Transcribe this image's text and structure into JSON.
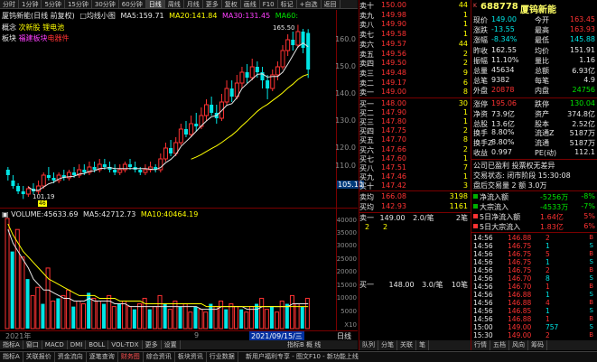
{
  "toolbar": {
    "title": "厦钨新能(日线 前复权)",
    "small_chart_label": "均线小图",
    "periods": [
      "分时",
      "1分钟",
      "5分钟",
      "15分钟",
      "30分钟",
      "60分钟",
      "日线",
      "周线",
      "月线",
      "更多"
    ],
    "actions": [
      "复权",
      "画线",
      "F10",
      "标记",
      "+自选",
      "返回"
    ],
    "ma5_label": "MA5:",
    "ma5_value": "159.71",
    "ma20_label": "MA20:",
    "ma20_value": "141.84",
    "ma30_label": "MA30:",
    "ma30_value": "131.45",
    "ma60_label": "MA60:"
  },
  "stock_tags": {
    "concept_label": "概念",
    "concept_value": "次新股 锂电池",
    "sector_label": "板块",
    "sector_value": "福建板块",
    "sector_extra": "电器件"
  },
  "price_axis": [
    "160.0",
    "150.0",
    "140.0",
    "130.0",
    "120.0",
    "110.0"
  ],
  "price_chart": {
    "high_label": "165.50",
    "low_label": "101.19",
    "current_price_tag": "105.10",
    "marker": "46"
  },
  "volume_panel": {
    "volume_label": "VOLUME:",
    "volume_value": "45633.69",
    "ma5_label": "MA5:",
    "ma5_value": "42712.73",
    "ma10_label": "MA10:",
    "ma10_value": "40464.19",
    "axis": [
      "40000",
      "35000",
      "30000",
      "25000",
      "20000",
      "15000",
      "10000",
      "5000"
    ],
    "unit_label": "X10",
    "volumes": [
      40,
      28,
      36,
      26,
      18,
      12,
      15,
      9,
      22,
      10,
      11,
      12,
      14,
      8,
      10,
      9,
      13,
      11,
      10,
      9,
      12,
      8,
      9,
      10,
      8,
      7,
      9,
      11,
      7,
      8,
      12,
      9,
      7,
      10,
      8,
      9,
      6,
      8,
      7,
      6,
      9,
      8,
      10,
      7,
      9,
      8,
      7,
      6,
      8,
      9,
      11,
      7,
      8,
      6,
      10,
      9,
      12,
      9,
      8,
      11
    ],
    "ma5_line": [
      36,
      31,
      28,
      25,
      22,
      18,
      16,
      14,
      14,
      13,
      12,
      11,
      11,
      10,
      10,
      10,
      11,
      10,
      10,
      10,
      10,
      9,
      9,
      9,
      8,
      8,
      8,
      8,
      8,
      8,
      8,
      8,
      8,
      8,
      8,
      8,
      8,
      8,
      7,
      7,
      7,
      7,
      8,
      8,
      8,
      8,
      8,
      7,
      7,
      7,
      8,
      8,
      8,
      8,
      8,
      8,
      9,
      9,
      9,
      9
    ],
    "ma10_line": [
      38,
      34,
      31,
      28,
      26,
      24,
      22,
      20,
      18,
      17,
      16,
      15,
      14,
      13,
      12,
      12,
      12,
      12,
      11,
      11,
      11,
      11,
      10,
      10,
      10,
      10,
      10,
      9,
      9,
      9,
      9,
      9,
      9,
      9,
      9,
      9,
      9,
      9,
      9,
      8,
      8,
      8,
      8,
      8,
      8,
      8,
      8,
      8,
      8,
      8,
      8,
      8,
      8,
      8,
      8,
      8,
      8,
      8,
      8,
      8
    ]
  },
  "date_axis": {
    "year_label": "2021年",
    "month_label": "9",
    "date_highlight": "2021/09/15/三",
    "period_label": "日线"
  },
  "bottom_tabs": [
    "指标A",
    "窗口",
    "MACD",
    "DMI",
    "BOLL",
    "VOL-TDX",
    "更多",
    "设置"
  ],
  "bottom_right": "指标B 概 线",
  "status_bar": [
    "指标A",
    "关联报价",
    "资金流向",
    "逐笔查询",
    "财务图",
    "综合资讯",
    "板块资讯",
    "行业数据"
  ],
  "status_right": "新用户福利专享 - 图文F10 - 新功能上线",
  "quote": {
    "code": "688778",
    "name": "厦钨新能",
    "badge": "K",
    "asks": [
      {
        "label": "卖十",
        "price": "150.00",
        "vol": "44"
      },
      {
        "label": "卖九",
        "price": "149.98",
        "vol": "1"
      },
      {
        "label": "卖八",
        "price": "149.90",
        "vol": "1"
      },
      {
        "label": "卖七",
        "price": "149.58",
        "vol": "1"
      },
      {
        "label": "卖六",
        "price": "149.57",
        "vol": "44"
      },
      {
        "label": "卖五",
        "price": "149.56",
        "vol": "2"
      },
      {
        "label": "卖四",
        "price": "149.50",
        "vol": "2"
      },
      {
        "label": "卖三",
        "price": "149.48",
        "vol": "9"
      },
      {
        "label": "卖二",
        "price": "149.17",
        "vol": "6"
      },
      {
        "label": "卖一",
        "price": "149.00",
        "vol": "8"
      }
    ],
    "bids": [
      {
        "label": "买一",
        "price": "148.00",
        "vol": "30"
      },
      {
        "label": "买二",
        "price": "147.90",
        "vol": "1"
      },
      {
        "label": "买三",
        "price": "147.80",
        "vol": "1"
      },
      {
        "label": "买四",
        "price": "147.75",
        "vol": "2"
      },
      {
        "label": "买五",
        "price": "147.70",
        "vol": "8"
      },
      {
        "label": "买六",
        "price": "147.66",
        "vol": "2"
      },
      {
        "label": "买七",
        "price": "147.60",
        "vol": "1"
      },
      {
        "label": "买八",
        "price": "147.51",
        "vol": "7"
      },
      {
        "label": "买九",
        "price": "147.46",
        "vol": "1"
      },
      {
        "label": "买十",
        "price": "147.42",
        "vol": "3"
      }
    ],
    "summary_left": [
      {
        "label": "卖均",
        "price": "166.08",
        "vol": "3198"
      },
      {
        "label": "买均",
        "price": "142.93",
        "vol": "1161"
      }
    ],
    "queue1": {
      "label": "卖一",
      "price": "149.00",
      "per": "2.0/笔",
      "count": "2笔",
      "vals": [
        "2",
        "2"
      ]
    },
    "queue2": {
      "label": "买一",
      "price": "148.00",
      "per": "3.0/笔",
      "count": "10笔"
    },
    "stats": [
      {
        "l": "现价",
        "v": "149.00",
        "l2": "今开",
        "v2": "163.45"
      },
      {
        "l": "涨跌",
        "v": "-13.55",
        "l2": "最高",
        "v2": "163.93"
      },
      {
        "l": "涨幅",
        "v": "-8.34%",
        "l2": "最低",
        "v2": "145.88"
      },
      {
        "l": "昨收",
        "v": "162.55",
        "l2": "均价",
        "v2": "151.91"
      },
      {
        "l": "振幅",
        "v": "11.10%",
        "l2": "量比",
        "v2": "1.16"
      },
      {
        "l": "总量",
        "v": "45634",
        "l2": "总额",
        "v2": "6.93亿"
      },
      {
        "l": "总笔",
        "v": "9382",
        "l2": "每笔",
        "v2": "4.9"
      },
      {
        "l": "外盘",
        "v": "20878",
        "l2": "内盘",
        "v2": "24756"
      }
    ],
    "stats2": [
      {
        "l": "涨停",
        "v": "195.06",
        "l2": "跌停",
        "v2": "130.04"
      },
      {
        "l": "净资",
        "v": "73.9亿",
        "l2": "资产",
        "v2": "374.8亿"
      },
      {
        "l": "总股",
        "v": "13.6亿",
        "l2": "股本",
        "v2": "2.52亿"
      },
      {
        "l": "换手",
        "v": "8.80%",
        "l2": "流通Z",
        "v2": "5187万"
      },
      {
        "l": "换手Z",
        "v": "8.80%",
        "l2": "流通",
        "v2": "5187万"
      },
      {
        "l": "收益",
        "v": "0.997",
        "l2": "PE(动)",
        "v2": "112.1"
      }
    ],
    "info_lines": [
      "公司已盈利 投票权无差异",
      "交易状态: 闭市阶段 15:30:08",
      "盘后交易量 2 额 3.0万"
    ],
    "flows": [
      {
        "l": "净流入额",
        "v": "-5256万",
        "p": "-8%"
      },
      {
        "l": "大宗流入",
        "v": "-4533万",
        "p": "-7%"
      },
      {
        "l": "5日净流入额",
        "v": "1.64亿",
        "p": "5%"
      },
      {
        "l": "5日大宗流入",
        "v": "1.83亿",
        "p": "6%"
      }
    ],
    "ticks_left": [
      {
        "t": "14:56",
        "p": "146.88",
        "v": "2"
      },
      {
        "t": "14:56",
        "p": "146.75",
        "v": "1"
      },
      {
        "t": "14:56",
        "p": "146.75",
        "v": "5"
      },
      {
        "t": "14:56",
        "p": "146.75",
        "v": "1"
      },
      {
        "t": "14:56",
        "p": "146.75",
        "v": "2"
      },
      {
        "t": "14:56",
        "p": "146.70",
        "v": "8"
      },
      {
        "t": "14:56",
        "p": "146.70",
        "v": "1"
      },
      {
        "t": "14:56",
        "p": "146.88",
        "v": "1"
      },
      {
        "t": "14:56",
        "p": "146.88",
        "v": "4"
      },
      {
        "t": "14:56",
        "p": "146.88",
        "v": "5"
      },
      {
        "t": "14:56",
        "p": "146.88",
        "v": "2"
      },
      {
        "t": "14:56",
        "p": "146.85",
        "v": "1"
      },
      {
        "t": "14:56",
        "p": "146.88",
        "v": "1"
      }
    ],
    "ticks_right": [
      {
        "t": "14:56",
        "p": "146.88",
        "v": "2"
      },
      {
        "t": "14:56",
        "p": "146.75",
        "v": "1"
      },
      {
        "t": "14:56",
        "p": "146.75",
        "v": "5"
      },
      {
        "t": "14:56",
        "p": "146.75",
        "v": "1"
      },
      {
        "t": "14:56",
        "p": "146.75",
        "v": "2"
      },
      {
        "t": "14:56",
        "p": "146.70",
        "v": "8"
      },
      {
        "t": "14:56",
        "p": "146.70",
        "v": "1"
      },
      {
        "t": "14:56",
        "p": "146.88",
        "v": "1"
      },
      {
        "t": "14:56",
        "p": "146.88",
        "v": "4"
      },
      {
        "t": "14:56",
        "p": "146.85",
        "v": "1"
      },
      {
        "t": "14:56",
        "p": "146.88",
        "v": "1"
      },
      {
        "t": "15:00",
        "p": "149.00",
        "v": "757"
      },
      {
        "t": "15:30",
        "p": "149.00",
        "v": "2"
      }
    ],
    "right_tabs": [
      "队列",
      "分笔",
      "关联",
      "笔",
      "行情",
      "五档",
      "风向",
      "筹码"
    ]
  },
  "colors": {
    "up": "#ff3232",
    "down": "#00e5e5",
    "ma_yellow": "#ffff00",
    "ma_white": "#e6e6e6"
  }
}
